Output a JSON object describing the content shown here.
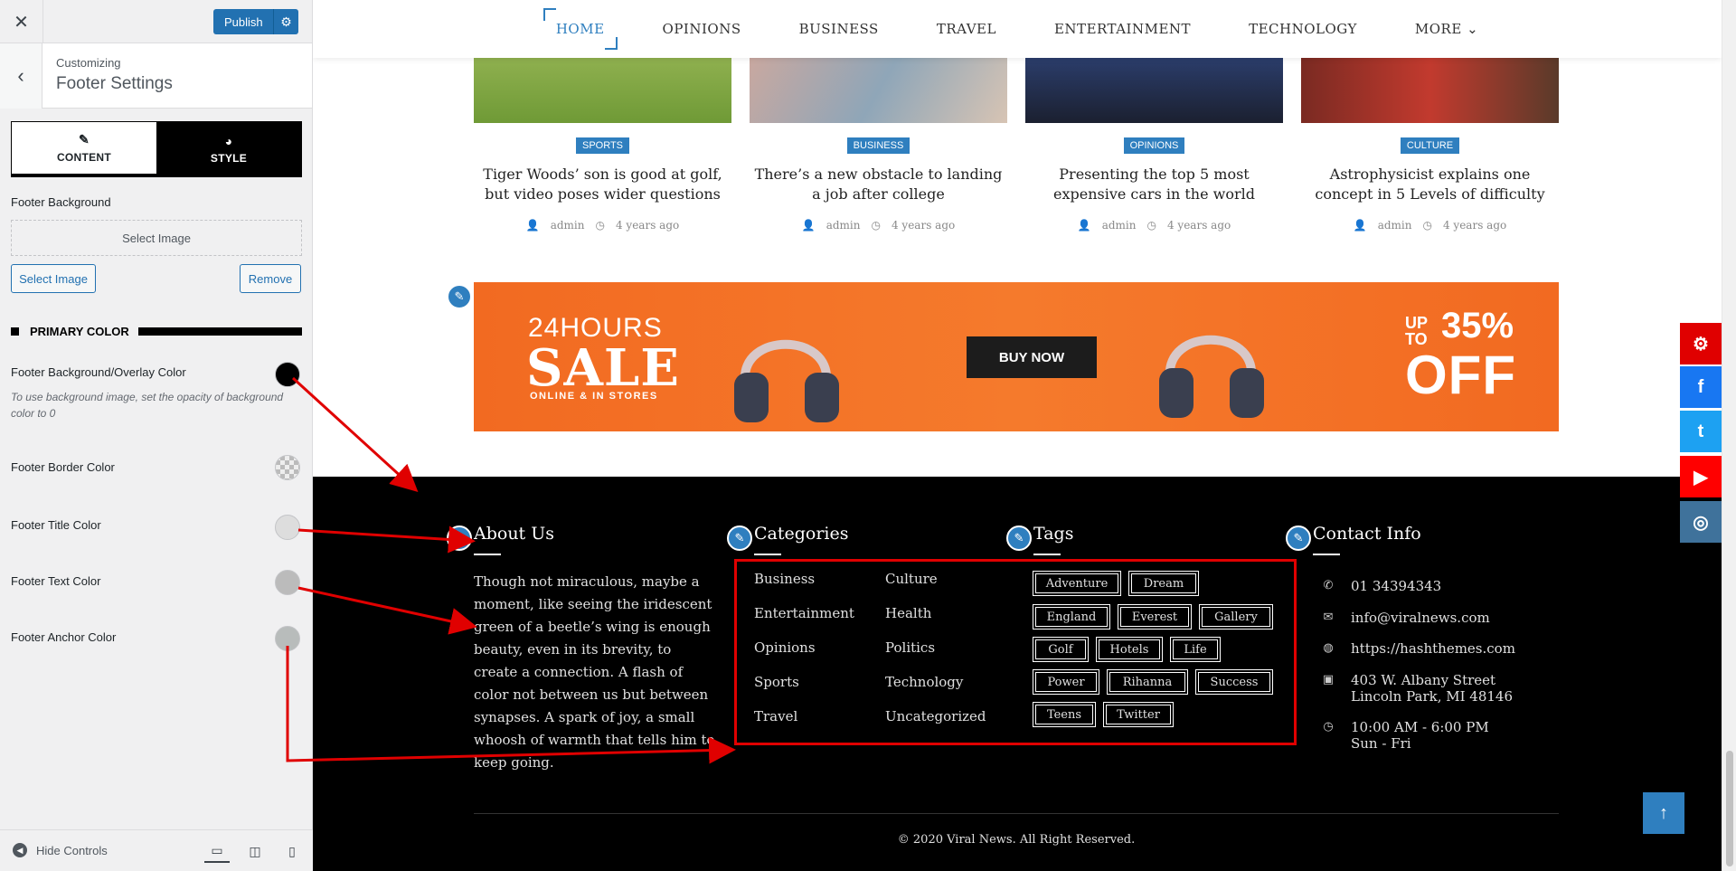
{
  "sidebar": {
    "publish_label": "Publish",
    "customizing": "Customizing",
    "section_title": "Footer Settings",
    "tabs": [
      {
        "label": "CONTENT"
      },
      {
        "label": "STYLE"
      }
    ],
    "footer_background_label": "Footer Background",
    "select_image_placeholder": "Select Image",
    "select_image_button": "Select Image",
    "remove_button": "Remove",
    "primary_color_heading": "PRIMARY COLOR",
    "color_settings": [
      {
        "label": "Footer Background/Overlay Color",
        "color": "#000000"
      },
      {
        "label": "Footer Border Color",
        "color": "transparent"
      },
      {
        "label": "Footer Title Color",
        "color": "#dddddd"
      },
      {
        "label": "Footer Text Color",
        "color": "#bbbbbb"
      },
      {
        "label": "Footer Anchor Color",
        "color": "#b8bcbb"
      }
    ],
    "help_text": "To use background image, set the opacity of background color to 0",
    "hide_controls": "Hide Controls"
  },
  "nav": {
    "items": [
      "HOME",
      "OPINIONS",
      "BUSINESS",
      "TRAVEL",
      "ENTERTAINMENT",
      "TECHNOLOGY",
      "MORE"
    ]
  },
  "cards": [
    {
      "category": "SPORTS",
      "title": "Tiger Woods’ son is good at golf, but video poses wider questions",
      "author": "admin",
      "time": "4 years ago"
    },
    {
      "category": "BUSINESS",
      "title": "There’s a new obstacle to landing a job after college",
      "author": "admin",
      "time": "4 years ago"
    },
    {
      "category": "OPINIONS",
      "title": "Presenting the top 5 most expensive cars in the world",
      "author": "admin",
      "time": "4 years ago"
    },
    {
      "category": "CULTURE",
      "title": "Astrophysicist explains one concept in 5 Levels of difficulty",
      "author": "admin",
      "time": "4 years ago"
    }
  ],
  "banner": {
    "line1": "24HOURS",
    "line2": "SALE",
    "line3": "ONLINE &  IN STORES",
    "button": "BUY NOW",
    "upto": "UP\nTO",
    "percent": "35%",
    "off": "OFF"
  },
  "footer": {
    "about_title": "About Us",
    "about_text": "Though not miraculous, maybe a moment, like seeing the iridescent green of a beetle’s wing is enough beauty, even in its brevity, to create a connection. A flash of color not between us but between synapses. A spark of joy, a small whoosh of warmth that tells him to keep going.",
    "categories_title": "Categories",
    "categories": [
      "Business",
      "Culture",
      "Entertainment",
      "Health",
      "Opinions",
      "Politics",
      "Sports",
      "Technology",
      "Travel",
      "Uncategorized"
    ],
    "tags_title": "Tags",
    "tags": [
      "Adventure",
      "Dream",
      "England",
      "Everest",
      "Gallery",
      "Golf",
      "Hotels",
      "Life",
      "Power",
      "Rihanna",
      "Success",
      "Teens",
      "Twitter"
    ],
    "contact_title": "Contact Info",
    "contact": {
      "phone": "01 34394343",
      "email": "info@viralnews.com",
      "website": "https://hashthemes.com",
      "address_line1": "403 W. Albany Street",
      "address_line2": "Lincoln Park, MI 48146",
      "hours_line1": "10:00 AM - 6:00 PM",
      "hours_line2": "Sun - Fri"
    },
    "copyright": "© 2020 Viral News. All Right Reserved."
  },
  "colors": {
    "accent": "#2f7fbf",
    "wp_blue": "#2271b1",
    "annotation_red": "#e00000",
    "facebook": "#1877f2",
    "twitter": "#1da1f2",
    "youtube": "#ff0000",
    "instagram": "#3f729b"
  },
  "icons": [
    "close-icon",
    "gear-icon",
    "chevron-left-icon",
    "edit-icon",
    "brush-icon",
    "pencil-icon",
    "phone-icon",
    "email-icon",
    "globe-icon",
    "map-icon",
    "clock-icon",
    "arrow-up-icon",
    "facebook-icon",
    "twitter-icon",
    "youtube-icon",
    "instagram-icon",
    "desktop-icon",
    "tablet-icon",
    "mobile-icon"
  ]
}
